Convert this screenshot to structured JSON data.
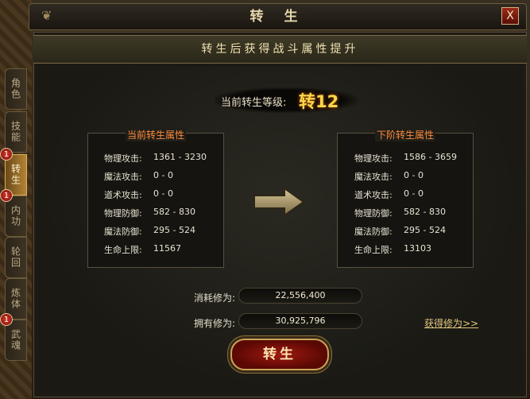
{
  "window": {
    "title": "转 生",
    "close_label": "X",
    "subtitle": "转生后获得战斗属性提升"
  },
  "tabs": [
    {
      "label": "角色",
      "active": false,
      "badge": ""
    },
    {
      "label": "技能",
      "active": false,
      "badge": ""
    },
    {
      "label": "转生",
      "active": true,
      "badge": "1"
    },
    {
      "label": "内功",
      "active": false,
      "badge": "1"
    },
    {
      "label": "轮回",
      "active": false,
      "badge": ""
    },
    {
      "label": "炼体",
      "active": false,
      "badge": ""
    },
    {
      "label": "武魂",
      "active": false,
      "badge": "1"
    }
  ],
  "level": {
    "label": "当前转生等级:",
    "value": "转12"
  },
  "current": {
    "title": "当前转生属性",
    "stats": [
      {
        "label": "物理攻击:",
        "value": "1361 - 3230"
      },
      {
        "label": "魔法攻击:",
        "value": "0 - 0"
      },
      {
        "label": "道术攻击:",
        "value": "0 - 0"
      },
      {
        "label": "物理防御:",
        "value": "582 - 830"
      },
      {
        "label": "魔法防御:",
        "value": "295 - 524"
      },
      {
        "label": "生命上限:",
        "value": "11567"
      }
    ]
  },
  "next": {
    "title": "下阶转生属性",
    "stats": [
      {
        "label": "物理攻击:",
        "value": "1586 - 3659"
      },
      {
        "label": "魔法攻击:",
        "value": "0 - 0"
      },
      {
        "label": "道术攻击:",
        "value": "0 - 0"
      },
      {
        "label": "物理防御:",
        "value": "582 - 830"
      },
      {
        "label": "魔法防御:",
        "value": "295 - 524"
      },
      {
        "label": "生命上限:",
        "value": "13103"
      }
    ]
  },
  "cost": {
    "label": "消耗修为:",
    "value": "22,556,400"
  },
  "owned": {
    "label": "拥有修为:",
    "value": "30,925,796"
  },
  "get_link": "获得修为>>",
  "action_button": "转生",
  "colors": {
    "accent_orange": "#ff8a3a",
    "level_gold": "#f7d84a",
    "button_red": "#a01a10"
  }
}
